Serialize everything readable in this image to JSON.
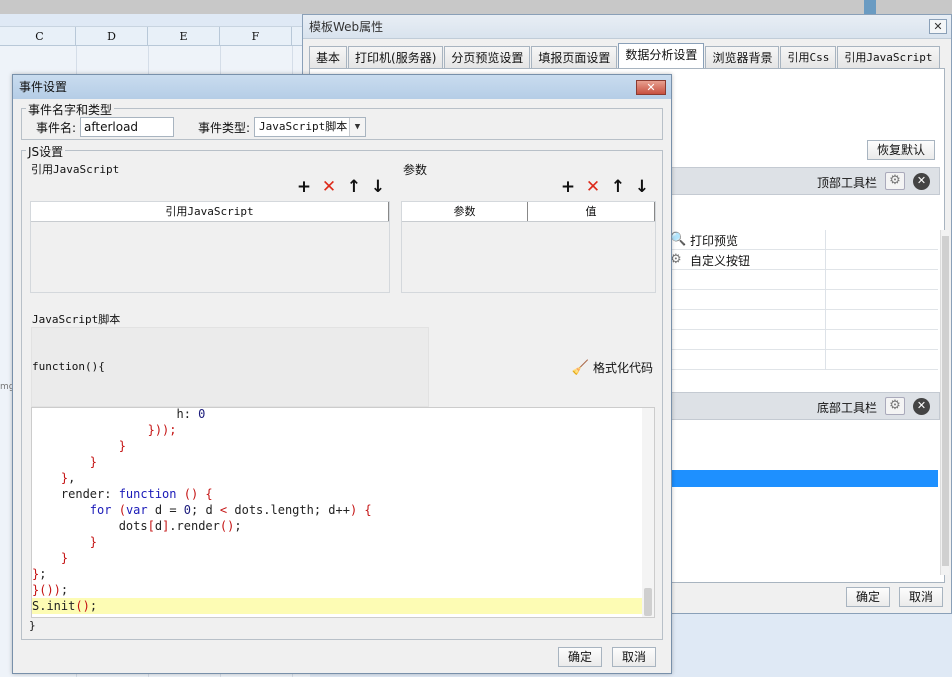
{
  "sheet": {
    "columns": [
      "C",
      "D",
      "E",
      "F"
    ],
    "side_text": "mg"
  },
  "web_window": {
    "title": "模板Web属性",
    "close": "✕",
    "tabs": [
      "基本",
      "打印机(服务器)",
      "分页预览设置",
      "填报页面设置",
      "数据分析设置",
      "浏览器背景",
      "引用Css",
      "引用JavaScript"
    ],
    "active_tab_index": 4,
    "restore_default": "恢复默认",
    "top_toolbar": "顶部工具栏",
    "bottom_toolbar": "底部工具栏",
    "toolbar_items": [
      {
        "icon": "print-preview-icon",
        "label": "打印预览"
      },
      {
        "icon": "gear-icon",
        "label": "自定义按钮"
      }
    ],
    "ok": "确定",
    "cancel": "取消",
    "selection_color": "#1e90ff"
  },
  "event_dialog": {
    "title": "事件设置",
    "close": "✕",
    "name_group": "事件名字和类型",
    "name_label": "事件名:",
    "name_value": "afterload",
    "type_label": "事件类型:",
    "type_value": "JavaScript脚本",
    "js_group": "JS设置",
    "ref_js_label": "引用JavaScript",
    "params_label": "参数",
    "ref_js_column": "引用JavaScript",
    "param_column": "参数",
    "value_column": "值",
    "script_label": "JavaScript脚本",
    "function_header": "function(){",
    "format_code": "格式化代码",
    "closing_brace": "}",
    "ok": "确定",
    "cancel": "取消",
    "code_lines": [
      "                    h: 0",
      "                }));",
      "            }",
      "        }",
      "    },",
      "    render: function () {",
      "        for (var d = 0; d < dots.length; d++) {",
      "            dots[d].render();",
      "        }",
      "    }",
      "};",
      "}());",
      "S.init();"
    ],
    "highlighted_line_index": 12
  }
}
